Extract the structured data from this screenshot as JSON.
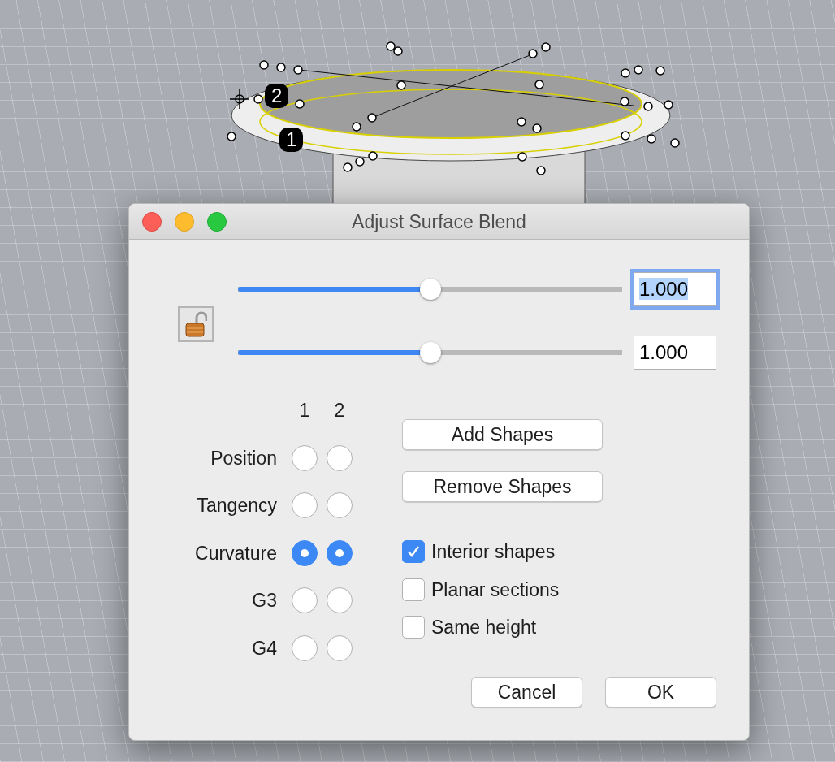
{
  "viewport": {
    "markers": [
      {
        "label": "2"
      },
      {
        "label": "1"
      }
    ]
  },
  "dialog": {
    "title": "Adjust Surface Blend",
    "lock": {
      "locked": false
    },
    "sliders": [
      {
        "level": 0.5,
        "value": "1.000",
        "focused": true
      },
      {
        "level": 0.5,
        "value": "1.000",
        "focused": false
      }
    ],
    "continuity": {
      "columns": [
        "1",
        "2"
      ],
      "rows": [
        {
          "label": "Position",
          "options": [
            {
              "selected": false
            },
            {
              "selected": false
            }
          ]
        },
        {
          "label": "Tangency",
          "options": [
            {
              "selected": false
            },
            {
              "selected": false
            }
          ]
        },
        {
          "label": "Curvature",
          "options": [
            {
              "selected": true
            },
            {
              "selected": true
            }
          ]
        },
        {
          "label": "G3",
          "options": [
            {
              "selected": false
            },
            {
              "selected": false
            }
          ]
        },
        {
          "label": "G4",
          "options": [
            {
              "selected": false
            },
            {
              "selected": false
            }
          ]
        }
      ]
    },
    "shape_buttons": [
      "Add Shapes",
      "Remove Shapes"
    ],
    "options": [
      {
        "label": "Interior shapes",
        "checked": true
      },
      {
        "label": "Planar sections",
        "checked": false
      },
      {
        "label": "Same height",
        "checked": false
      }
    ],
    "buttons": [
      "Cancel",
      "OK"
    ]
  }
}
